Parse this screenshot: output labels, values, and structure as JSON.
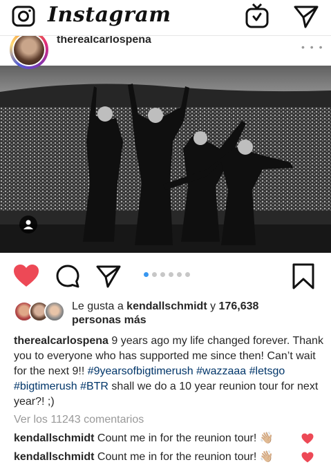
{
  "topbar": {
    "logo": "Instagram",
    "icons": [
      "camera-icon",
      "igtv-icon",
      "direct-icon"
    ]
  },
  "post": {
    "username": "therealcarlospena",
    "more": "• • •",
    "image_description": "black-and-white concert stage photo",
    "carousel": {
      "count": 6,
      "active": 0
    }
  },
  "likes": {
    "prefix": "Le gusta a ",
    "user": "kendallschmidt",
    "middle": " y ",
    "count": "176,638",
    "suffix": "personas más"
  },
  "caption": {
    "user": "therealcarlospena",
    "text1": " 9 years ago my life changed forever. Thank you to everyone who has supported me since then! Can’t wait for the next 9!! ",
    "tag1": "#9yearsofbigtimerush",
    "tag2": "#wazzaaa",
    "tag3": "#letsgo",
    "tag4": "#bigtimerush",
    "tag5": "#BTR",
    "text2": " shall we do a 10 year reunion tour for next year?! ;)"
  },
  "view_comments": "Ver los 11243 comentarios",
  "comments": [
    {
      "user": "kendallschmidt",
      "text": " Count me in for the reunion tour! 👋🏼"
    },
    {
      "user": "kendallschmidt",
      "text": " Count me in for the reunion tour! 👋🏼"
    }
  ],
  "colors": {
    "like_red": "#ed4956",
    "hashtag_blue": "#003569",
    "active_dot": "#3897f0",
    "muted_text": "#999999"
  }
}
